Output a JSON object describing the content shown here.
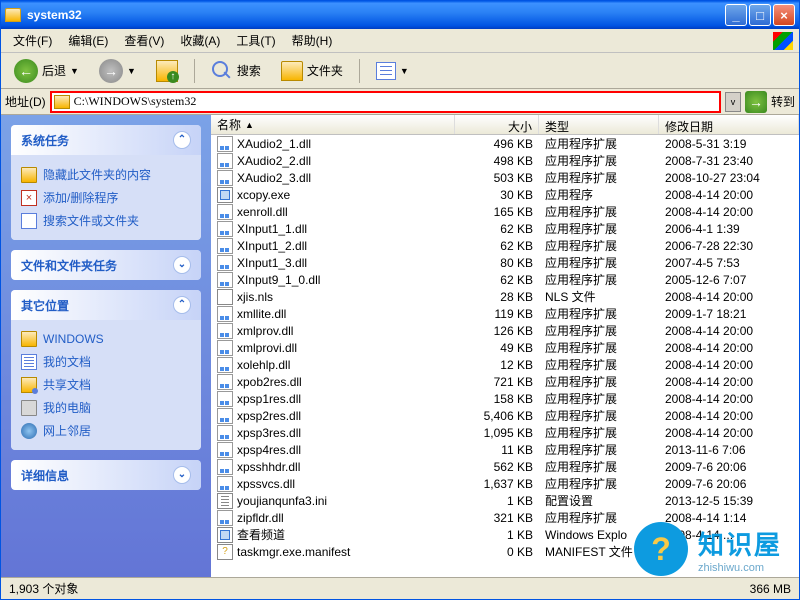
{
  "window": {
    "title": "system32"
  },
  "menu": {
    "file": "文件(F)",
    "edit": "编辑(E)",
    "view": "查看(V)",
    "fav": "收藏(A)",
    "tools": "工具(T)",
    "help": "帮助(H)"
  },
  "toolbar": {
    "back": "后退",
    "search": "搜索",
    "folders": "文件夹"
  },
  "address": {
    "label": "地址(D)",
    "value": "C:\\WINDOWS\\system32",
    "go": "转到"
  },
  "sidebar": {
    "tasks": {
      "title": "系统任务",
      "items": [
        {
          "icon": "folder",
          "label": "隐藏此文件夹的内容"
        },
        {
          "icon": "del",
          "label": "添加/删除程序"
        },
        {
          "icon": "search",
          "label": "搜索文件或文件夹"
        }
      ]
    },
    "filetasks": {
      "title": "文件和文件夹任务"
    },
    "other": {
      "title": "其它位置",
      "items": [
        {
          "icon": "folder",
          "label": "WINDOWS"
        },
        {
          "icon": "doc",
          "label": "我的文档"
        },
        {
          "icon": "share",
          "label": "共享文档"
        },
        {
          "icon": "pc",
          "label": "我的电脑"
        },
        {
          "icon": "net",
          "label": "网上邻居"
        }
      ]
    },
    "details": {
      "title": "详细信息"
    }
  },
  "columns": {
    "name": "名称",
    "size": "大小",
    "type": "类型",
    "modified": "修改日期"
  },
  "files": [
    {
      "ico": "dll",
      "name": "XAudio2_1.dll",
      "size": "496 KB",
      "type": "应用程序扩展",
      "date": "2008-5-31 3:19"
    },
    {
      "ico": "dll",
      "name": "XAudio2_2.dll",
      "size": "498 KB",
      "type": "应用程序扩展",
      "date": "2008-7-31 23:40"
    },
    {
      "ico": "dll",
      "name": "XAudio2_3.dll",
      "size": "503 KB",
      "type": "应用程序扩展",
      "date": "2008-10-27 23:04"
    },
    {
      "ico": "exe",
      "name": "xcopy.exe",
      "size": "30 KB",
      "type": "应用程序",
      "date": "2008-4-14 20:00"
    },
    {
      "ico": "dll",
      "name": "xenroll.dll",
      "size": "165 KB",
      "type": "应用程序扩展",
      "date": "2008-4-14 20:00"
    },
    {
      "ico": "dll",
      "name": "XInput1_1.dll",
      "size": "62 KB",
      "type": "应用程序扩展",
      "date": "2006-4-1 1:39"
    },
    {
      "ico": "dll",
      "name": "XInput1_2.dll",
      "size": "62 KB",
      "type": "应用程序扩展",
      "date": "2006-7-28 22:30"
    },
    {
      "ico": "dll",
      "name": "XInput1_3.dll",
      "size": "80 KB",
      "type": "应用程序扩展",
      "date": "2007-4-5 7:53"
    },
    {
      "ico": "dll",
      "name": "XInput9_1_0.dll",
      "size": "62 KB",
      "type": "应用程序扩展",
      "date": "2005-12-6 7:07"
    },
    {
      "ico": "nls",
      "name": "xjis.nls",
      "size": "28 KB",
      "type": "NLS 文件",
      "date": "2008-4-14 20:00"
    },
    {
      "ico": "dll",
      "name": "xmllite.dll",
      "size": "119 KB",
      "type": "应用程序扩展",
      "date": "2009-1-7 18:21"
    },
    {
      "ico": "dll",
      "name": "xmlprov.dll",
      "size": "126 KB",
      "type": "应用程序扩展",
      "date": "2008-4-14 20:00"
    },
    {
      "ico": "dll",
      "name": "xmlprovi.dll",
      "size": "49 KB",
      "type": "应用程序扩展",
      "date": "2008-4-14 20:00"
    },
    {
      "ico": "dll",
      "name": "xolehlp.dll",
      "size": "12 KB",
      "type": "应用程序扩展",
      "date": "2008-4-14 20:00"
    },
    {
      "ico": "dll",
      "name": "xpob2res.dll",
      "size": "721 KB",
      "type": "应用程序扩展",
      "date": "2008-4-14 20:00"
    },
    {
      "ico": "dll",
      "name": "xpsp1res.dll",
      "size": "158 KB",
      "type": "应用程序扩展",
      "date": "2008-4-14 20:00"
    },
    {
      "ico": "dll",
      "name": "xpsp2res.dll",
      "size": "5,406 KB",
      "type": "应用程序扩展",
      "date": "2008-4-14 20:00"
    },
    {
      "ico": "dll",
      "name": "xpsp3res.dll",
      "size": "1,095 KB",
      "type": "应用程序扩展",
      "date": "2008-4-14 20:00"
    },
    {
      "ico": "dll",
      "name": "xpsp4res.dll",
      "size": "11 KB",
      "type": "应用程序扩展",
      "date": "2013-11-6 7:06"
    },
    {
      "ico": "dll",
      "name": "xpsshhdr.dll",
      "size": "562 KB",
      "type": "应用程序扩展",
      "date": "2009-7-6 20:06"
    },
    {
      "ico": "dll",
      "name": "xpssvcs.dll",
      "size": "1,637 KB",
      "type": "应用程序扩展",
      "date": "2009-7-6 20:06"
    },
    {
      "ico": "ini",
      "name": "youjianqunfa3.ini",
      "size": "1 KB",
      "type": "配置设置",
      "date": "2013-12-5 15:39"
    },
    {
      "ico": "dll",
      "name": "zipfldr.dll",
      "size": "321 KB",
      "type": "应用程序扩展",
      "date": "2008-4-14 1:14"
    },
    {
      "ico": "exe",
      "name": "查看频道",
      "size": "1 KB",
      "type": "Windows Explo",
      "date": "2008-4-14 ..."
    },
    {
      "ico": "man",
      "name": "taskmgr.exe.manifest",
      "size": "0 KB",
      "type": "MANIFEST 文件",
      "date": ""
    }
  ],
  "status": {
    "objects": "1,903 个对象",
    "size": "366 MB"
  },
  "watermark": {
    "name": "知识屋",
    "url": "zhishiwu.com",
    "q": "?"
  }
}
